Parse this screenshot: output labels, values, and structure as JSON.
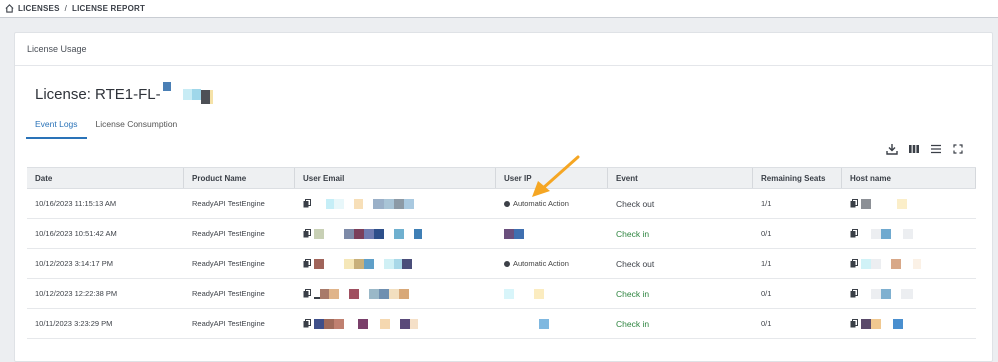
{
  "breadcrumb": {
    "root": "LICENSES",
    "separator": "/",
    "current": "LICENSE REPORT"
  },
  "panel": {
    "title": "License Usage"
  },
  "license": {
    "label": "License: RTE1-FL-"
  },
  "tabs": [
    {
      "label": "Event Logs",
      "active": true
    },
    {
      "label": "License Consumption",
      "active": false
    }
  ],
  "toolbar": {
    "icons": [
      "download-icon",
      "columns-icon",
      "density-icon",
      "fullscreen-icon"
    ]
  },
  "table": {
    "columns": [
      "Date",
      "Product Name",
      "User Email",
      "User IP",
      "Event",
      "Remaining Seats",
      "Host name"
    ],
    "rows": [
      {
        "date": "10/16/2023 11:15:13 AM",
        "product": "ReadyAPI TestEngine",
        "ip": "Automatic Action",
        "event": "Check out",
        "seats": "1/1"
      },
      {
        "date": "10/16/2023 10:51:42 AM",
        "product": "ReadyAPI TestEngine",
        "ip": "",
        "event": "Check in",
        "seats": "0/1"
      },
      {
        "date": "10/12/2023 3:14:17 PM",
        "product": "ReadyAPI TestEngine",
        "ip": "Automatic Action",
        "event": "Check out",
        "seats": "1/1"
      },
      {
        "date": "10/12/2023 12:22:38 PM",
        "product": "ReadyAPI TestEngine",
        "ip": "",
        "event": "Check in",
        "seats": "0/1"
      },
      {
        "date": "10/11/2023 3:23:29 PM",
        "product": "ReadyAPI TestEngine",
        "ip": "",
        "event": "Check in",
        "seats": "0/1"
      }
    ]
  },
  "colors": {
    "accent": "#2a73b8",
    "check_in": "#2e8540",
    "annotation_arrow": "#f5a623"
  }
}
